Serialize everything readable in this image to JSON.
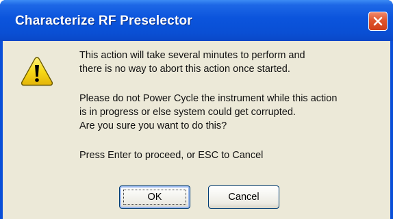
{
  "dialog": {
    "title": "Characterize RF Preselector",
    "icon": "warning-icon",
    "close_icon": "close-icon",
    "colors": {
      "titlebar": "#0a4fd8",
      "client": "#ece9d8",
      "close_button": "#e0552d",
      "warning_yellow": "#f7d917"
    },
    "paragraphs": [
      {
        "lines": [
          "This action will take several minutes to perform and",
          "there is no way to abort this action once started."
        ]
      },
      {
        "lines": [
          "Please do not Power Cycle the instrument while this action",
          "is in progress or else system could get corrupted.",
          "Are you sure you want to do this?"
        ]
      },
      {
        "lines": [
          "Press Enter to proceed, or ESC to Cancel"
        ]
      }
    ],
    "buttons": {
      "ok_label": "OK",
      "cancel_label": "Cancel"
    }
  }
}
